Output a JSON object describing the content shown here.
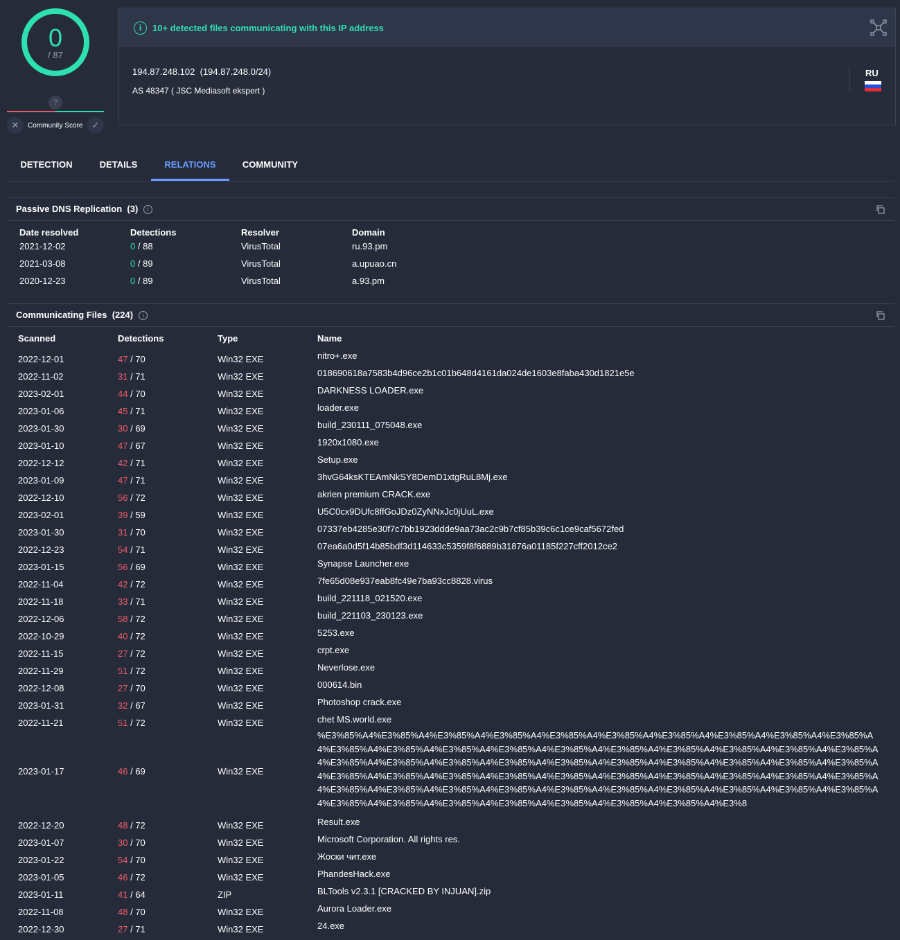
{
  "score": {
    "detected": "0",
    "total": "/ 87",
    "community_unknown": "?",
    "community_label": "Community Score"
  },
  "banner": {
    "text": "10+ detected files communicating with this IP address"
  },
  "ip": {
    "address": "194.87.248.102",
    "network": "(194.87.248.0/24)",
    "as": "AS 48347 ( JSC Mediasoft ekspert )",
    "country": "RU"
  },
  "tabs": [
    "DETECTION",
    "DETAILS",
    "RELATIONS",
    "COMMUNITY"
  ],
  "active_tab": "RELATIONS",
  "dns": {
    "title": "Passive DNS Replication",
    "count": "(3)",
    "headers": [
      "Date resolved",
      "Detections",
      "Resolver",
      "Domain"
    ],
    "rows": [
      {
        "date": "2021-12-02",
        "pos": "0",
        "tot": "/ 88",
        "resolver": "VirusTotal",
        "domain": "ru.93.pm"
      },
      {
        "date": "2021-03-08",
        "pos": "0",
        "tot": "/ 89",
        "resolver": "VirusTotal",
        "domain": "a.upuao.cn"
      },
      {
        "date": "2020-12-23",
        "pos": "0",
        "tot": "/ 89",
        "resolver": "VirusTotal",
        "domain": "a.93.pm"
      }
    ]
  },
  "files": {
    "title": "Communicating Files",
    "count": "(224)",
    "headers": [
      "Scanned",
      "Detections",
      "Type",
      "Name"
    ],
    "rows": [
      {
        "date": "2022-12-01",
        "pos": "47",
        "tot": "/ 70",
        "type": "Win32 EXE",
        "name": "nitro+.exe"
      },
      {
        "date": "2022-11-02",
        "pos": "31",
        "tot": "/ 71",
        "type": "Win32 EXE",
        "name": "018690618a7583b4d96ce2b1c01b648d4161da024de1603e8faba430d1821e5e"
      },
      {
        "date": "2023-02-01",
        "pos": "44",
        "tot": "/ 70",
        "type": "Win32 EXE",
        "name": "DARKNESS LOADER.exe"
      },
      {
        "date": "2023-01-06",
        "pos": "45",
        "tot": "/ 71",
        "type": "Win32 EXE",
        "name": "loader.exe"
      },
      {
        "date": "2023-01-30",
        "pos": "30",
        "tot": "/ 69",
        "type": "Win32 EXE",
        "name": "build_230111_075048.exe"
      },
      {
        "date": "2023-01-10",
        "pos": "47",
        "tot": "/ 67",
        "type": "Win32 EXE",
        "name": "1920x1080.exe"
      },
      {
        "date": "2022-12-12",
        "pos": "42",
        "tot": "/ 71",
        "type": "Win32 EXE",
        "name": "Setup.exe"
      },
      {
        "date": "2023-01-09",
        "pos": "47",
        "tot": "/ 71",
        "type": "Win32 EXE",
        "name": "3hvG64ksKTEAmNkSY8DemD1xtgRuL8Mj.exe"
      },
      {
        "date": "2022-12-10",
        "pos": "56",
        "tot": "/ 72",
        "type": "Win32 EXE",
        "name": "akrien premium CRACK.exe"
      },
      {
        "date": "2023-02-01",
        "pos": "39",
        "tot": "/ 59",
        "type": "Win32 EXE",
        "name": "U5C0cx9DUfc8ffGoJDz0ZyNNxJc0jUuL.exe"
      },
      {
        "date": "2023-01-30",
        "pos": "31",
        "tot": "/ 70",
        "type": "Win32 EXE",
        "name": "07337eb4285e30f7c7bb1923ddde9aa73ac2c9b7cf85b39c6c1ce9caf5672fed"
      },
      {
        "date": "2022-12-23",
        "pos": "54",
        "tot": "/ 71",
        "type": "Win32 EXE",
        "name": "07ea6a0d5f14b85bdf3d114633c5359f8f6889b31876a01185f227cff2012ce2"
      },
      {
        "date": "2023-01-15",
        "pos": "56",
        "tot": "/ 69",
        "type": "Win32 EXE",
        "name": "Synapse Launcher.exe"
      },
      {
        "date": "2022-11-04",
        "pos": "42",
        "tot": "/ 72",
        "type": "Win32 EXE",
        "name": "7fe65d08e937eab8fc49e7ba93cc8828.virus"
      },
      {
        "date": "2022-11-18",
        "pos": "33",
        "tot": "/ 71",
        "type": "Win32 EXE",
        "name": "build_221118_021520.exe"
      },
      {
        "date": "2022-12-06",
        "pos": "58",
        "tot": "/ 72",
        "type": "Win32 EXE",
        "name": "build_221103_230123.exe"
      },
      {
        "date": "2022-10-29",
        "pos": "40",
        "tot": "/ 72",
        "type": "Win32 EXE",
        "name": "5253.exe"
      },
      {
        "date": "2022-11-15",
        "pos": "27",
        "tot": "/ 72",
        "type": "Win32 EXE",
        "name": "crpt.exe"
      },
      {
        "date": "2022-11-29",
        "pos": "51",
        "tot": "/ 72",
        "type": "Win32 EXE",
        "name": "Neverlose.exe"
      },
      {
        "date": "2022-12-08",
        "pos": "27",
        "tot": "/ 70",
        "type": "Win32 EXE",
        "name": "000614.bin"
      },
      {
        "date": "2023-01-31",
        "pos": "32",
        "tot": "/ 67",
        "type": "Win32 EXE",
        "name": "Photoshop crack.exe"
      },
      {
        "date": "2022-11-21",
        "pos": "51",
        "tot": "/ 72",
        "type": "Win32 EXE",
        "name": "chet MS.world.exe"
      }
    ],
    "long_row": {
      "date": "2023-01-17",
      "pos": "46",
      "tot": "/ 69",
      "type": "Win32 EXE",
      "name": "%E3%85%A4%E3%85%A4%E3%85%A4%E3%85%A4%E3%85%A4%E3%85%A4%E3%85%A4%E3%85%A4%E3%85%A4%E3%85%A4%E3%85%A4%E3%85%A4%E3%85%A4%E3%85%A4%E3%85%A4%E3%85%A4%E3%85%A4%E3%85%A4%E3%85%A4%E3%85%A4%E3%85%A4%E3%85%A4%E3%85%A4%E3%85%A4%E3%85%A4%E3%85%A4%E3%85%A4%E3%85%A4%E3%85%A4%E3%85%A4%E3%85%A4%E3%85%A4%E3%85%A4%E3%85%A4%E3%85%A4%E3%85%A4%E3%85%A4%E3%85%A4%E3%85%A4%E3%85%A4%E3%85%A4%E3%85%A4%E3%85%A4%E3%85%A4%E3%85%A4%E3%85%A4%E3%85%A4%E3%85%A4%E3%85%A4%E3%85%A4%E3%85%A4%E3%85%A4%E3%85%A4%E3%85%A4%E3%85%A4%E3%85%A4%E3%85%A4%E3%8"
    },
    "rows_after": [
      {
        "date": "2022-12-20",
        "pos": "48",
        "tot": "/ 72",
        "type": "Win32 EXE",
        "name": "Result.exe"
      },
      {
        "date": "2023-01-07",
        "pos": "30",
        "tot": "/ 70",
        "type": "Win32 EXE",
        "name": "Microsoft Corporation. All rights res."
      },
      {
        "date": "2023-01-22",
        "pos": "54",
        "tot": "/ 70",
        "type": "Win32 EXE",
        "name": "Жоски чит.exe"
      },
      {
        "date": "2023-01-05",
        "pos": "46",
        "tot": "/ 72",
        "type": "Win32 EXE",
        "name": "PhandesHack.exe"
      },
      {
        "date": "2023-01-11",
        "pos": "41",
        "tot": "/ 64",
        "type": "ZIP",
        "name": "BLTools v2.3.1 [CRACKED BY INJUAN].zip"
      },
      {
        "date": "2022-11-08",
        "pos": "48",
        "tot": "/ 70",
        "type": "Win32 EXE",
        "name": "Aurora Loader.exe"
      },
      {
        "date": "2022-12-30",
        "pos": "27",
        "tot": "/ 71",
        "type": "Win32 EXE",
        "name": "24.exe"
      }
    ]
  },
  "colors": {
    "accent": "#2ee0b0",
    "malicious": "#f05c6a",
    "tab_active": "#6b9cff",
    "background": "#262b3a"
  }
}
